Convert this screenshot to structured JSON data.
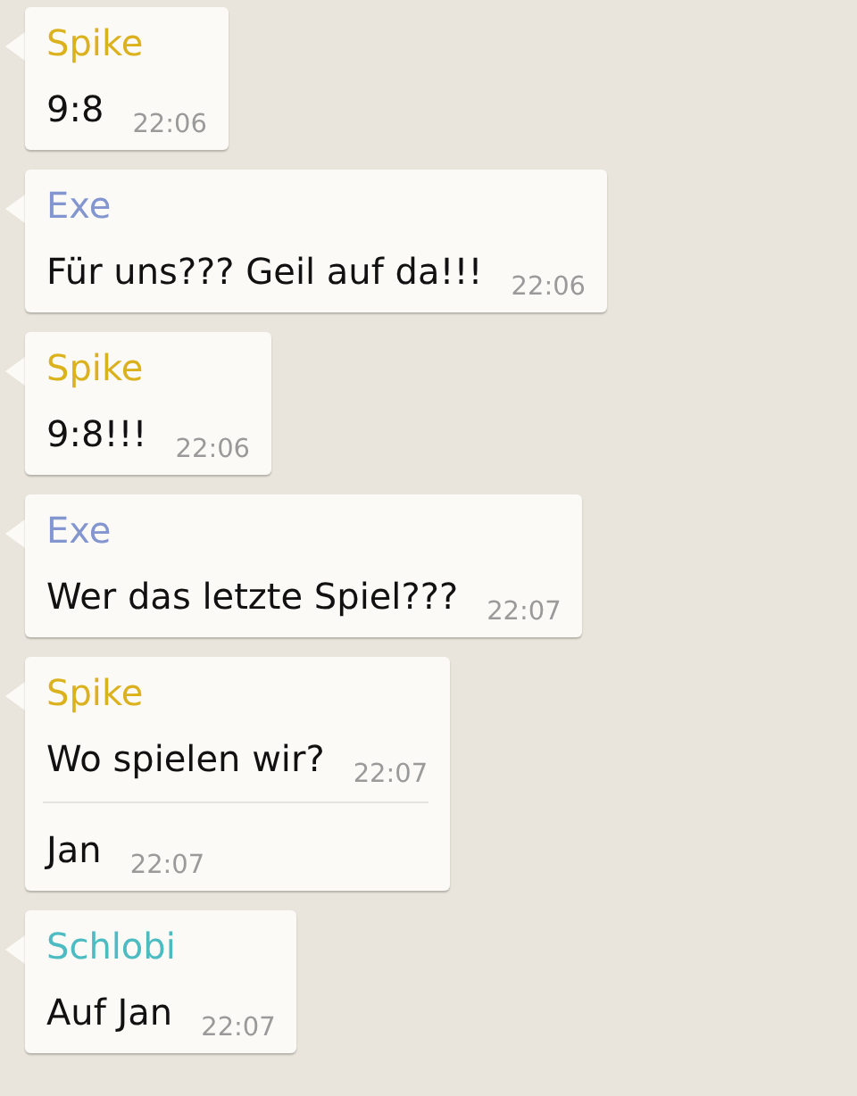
{
  "messages": [
    {
      "sender": "Spike",
      "color": "#dbb21e",
      "lines": [
        {
          "text": "9:8",
          "time": "22:06"
        }
      ]
    },
    {
      "sender": "Exe",
      "color": "#8496cf",
      "lines": [
        {
          "text": "Für uns??? Geil auf da!!!",
          "time": "22:06"
        }
      ]
    },
    {
      "sender": "Spike",
      "color": "#dbb21e",
      "lines": [
        {
          "text": "9:8!!!",
          "time": "22:06"
        }
      ]
    },
    {
      "sender": "Exe",
      "color": "#8496cf",
      "lines": [
        {
          "text": "Wer das letzte Spiel???",
          "time": "22:07"
        }
      ]
    },
    {
      "sender": "Spike",
      "color": "#dbb21e",
      "lines": [
        {
          "text": "Wo spielen wir?",
          "time": "22:07"
        },
        {
          "text": "Jan",
          "time": "22:07"
        }
      ]
    },
    {
      "sender": "Schlobi",
      "color": "#4cbcc2",
      "lines": [
        {
          "text": "Auf Jan",
          "time": "22:07"
        }
      ]
    }
  ]
}
